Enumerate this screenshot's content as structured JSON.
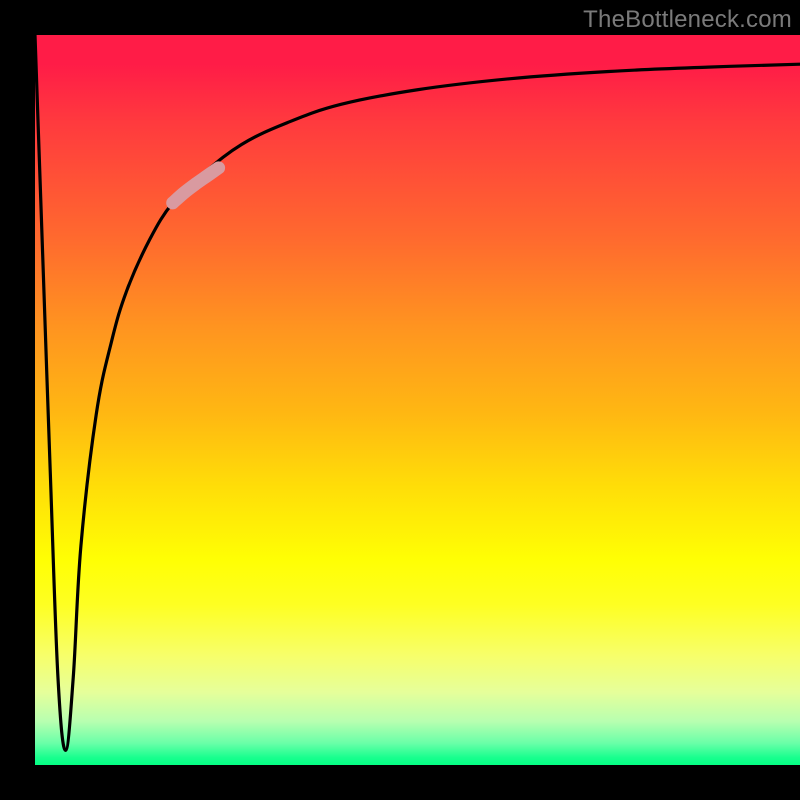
{
  "watermark": "TheBottleneck.com",
  "chart_data": {
    "type": "line",
    "title": "",
    "xlabel": "",
    "ylabel": "",
    "xlim": [
      0,
      100
    ],
    "ylim": [
      0,
      100
    ],
    "grid": false,
    "legend": false,
    "annotations": [],
    "series": [
      {
        "name": "bottleneck-curve",
        "color": "#000000",
        "x": [
          0,
          1,
          2,
          3,
          4,
          5,
          6,
          8,
          10,
          12,
          15,
          18,
          22,
          27,
          33,
          40,
          50,
          62,
          75,
          88,
          100
        ],
        "y": [
          100,
          70,
          40,
          12,
          2,
          12,
          30,
          48,
          58,
          65,
          72,
          77,
          81,
          85,
          88,
          90.5,
          92.5,
          94,
          95,
          95.6,
          96
        ]
      },
      {
        "name": "highlight-segment",
        "color": "#d99aa0",
        "x": [
          18,
          19.5,
          21,
          22.5,
          24
        ],
        "y": [
          77,
          78.4,
          79.6,
          80.7,
          81.8
        ]
      }
    ]
  },
  "colors": {
    "gradient_top": "#ff1c47",
    "gradient_bottom": "#04ff84",
    "curve": "#000000",
    "highlight": "#d99aa0",
    "frame": "#000000"
  }
}
